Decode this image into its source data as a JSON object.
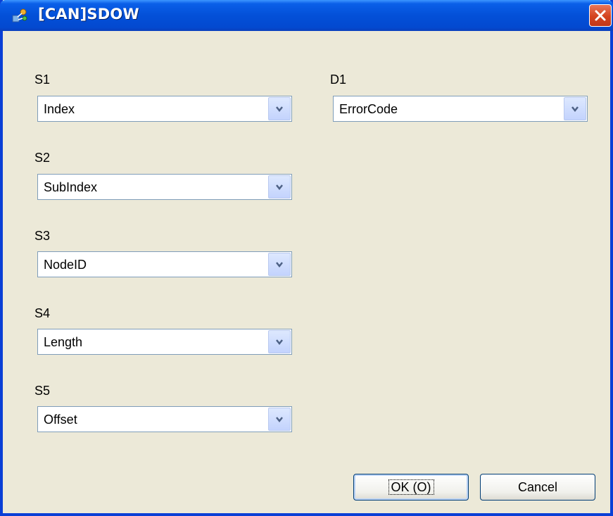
{
  "window": {
    "title": "[CAN]SDOW"
  },
  "fields": {
    "s1": {
      "label": "S1",
      "value": "Index"
    },
    "s2": {
      "label": "S2",
      "value": "SubIndex"
    },
    "s3": {
      "label": "S3",
      "value": "NodeID"
    },
    "s4": {
      "label": "S4",
      "value": "Length"
    },
    "s5": {
      "label": "S5",
      "value": "Offset"
    },
    "d1": {
      "label": "D1",
      "value": "ErrorCode"
    }
  },
  "buttons": {
    "ok": "OK (O)",
    "cancel": "Cancel"
  },
  "icons": {
    "app": "app-network-icon",
    "close": "close-icon",
    "dropdown": "chevron-down-icon"
  },
  "colors": {
    "titlebar": "#0a5fe8",
    "close": "#d4441f",
    "face": "#ece9d8",
    "combo_border": "#7f9db9"
  }
}
